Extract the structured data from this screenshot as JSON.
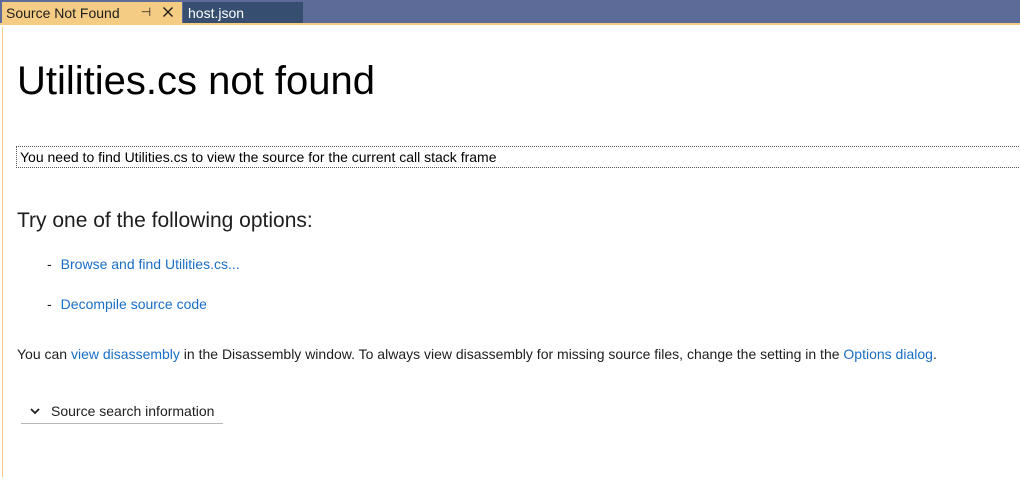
{
  "tabs": {
    "active": {
      "label": "Source Not Found",
      "pin_glyph": "⊣"
    },
    "inactive": {
      "label": "host.json"
    }
  },
  "page": {
    "title": "Utilities.cs not found",
    "need_text": "You need to find Utilities.cs to view the source for the current call stack frame",
    "options_heading": "Try one of the following options:",
    "options": [
      {
        "dash": "-",
        "label": "Browse and find Utilities.cs..."
      },
      {
        "dash": "-",
        "label": "Decompile source code"
      }
    ],
    "info": {
      "prefix": "You can ",
      "link1": "view disassembly",
      "middle": " in the Disassembly window. To always view disassembly for missing source files, change the setting in the ",
      "link2": "Options dialog",
      "suffix": "."
    },
    "expander_label": "Source search information"
  },
  "colors": {
    "tab_bar": "#5d6b99",
    "active_tab": "#f5cc84",
    "inactive_tab": "#364e6f",
    "link": "#1a6ec6"
  },
  "icons": {
    "pin": "pin-icon",
    "close": "close-icon",
    "chevron": "chevron-down-icon"
  }
}
